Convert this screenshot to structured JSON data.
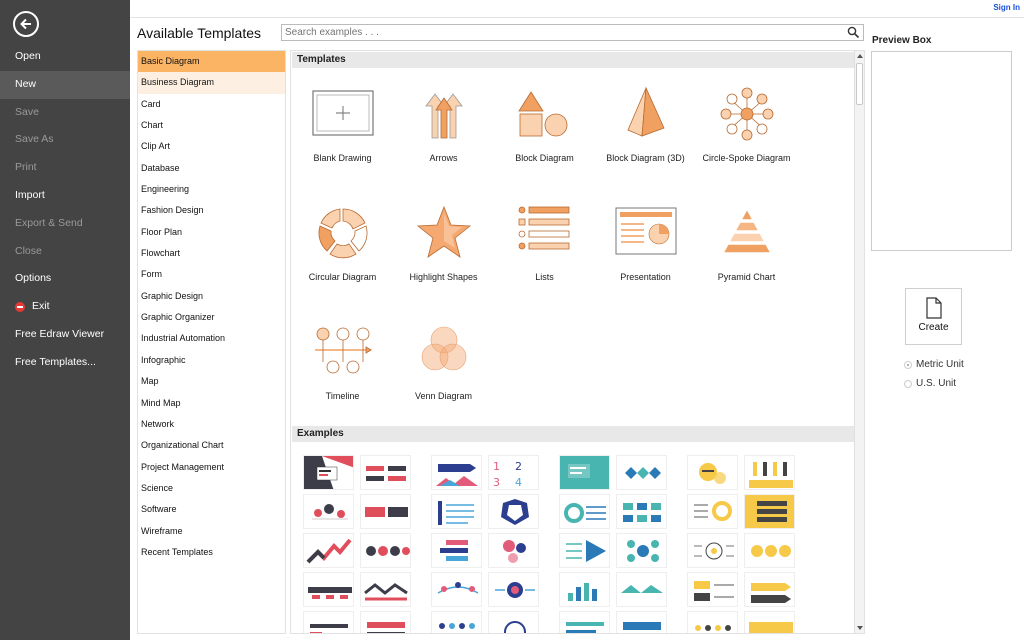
{
  "sidebar": {
    "items": [
      {
        "label": "Open",
        "state": "normal"
      },
      {
        "label": "New",
        "state": "active"
      },
      {
        "label": "Save",
        "state": "disabled"
      },
      {
        "label": "Save As",
        "state": "disabled"
      },
      {
        "label": "Print",
        "state": "disabled"
      },
      {
        "label": "Import",
        "state": "normal"
      },
      {
        "label": "Export & Send",
        "state": "disabled"
      },
      {
        "label": "Close",
        "state": "disabled"
      },
      {
        "label": "Options",
        "state": "normal"
      },
      {
        "label": "Exit",
        "state": "normal",
        "icon": "exit-icon"
      },
      {
        "label": "Free Edraw Viewer",
        "state": "normal"
      },
      {
        "label": "Free Templates...",
        "state": "normal"
      }
    ]
  },
  "header": {
    "signin": "Sign In",
    "title": "Available Templates",
    "search_placeholder": "Search examples . . ."
  },
  "categories": {
    "items": [
      "Basic Diagram",
      "Business Diagram",
      "Card",
      "Chart",
      "Clip Art",
      "Database",
      "Engineering",
      "Fashion Design",
      "Floor Plan",
      "Flowchart",
      "Form",
      "Graphic Design",
      "Graphic Organizer",
      "Industrial Automation",
      "Infographic",
      "Map",
      "Mind Map",
      "Network",
      "Organizational Chart",
      "Project Management",
      "Science",
      "Software",
      "Wireframe",
      "Recent Templates"
    ],
    "selected": "Basic Diagram",
    "hovered": "Business Diagram"
  },
  "main": {
    "templates_header": "Templates",
    "examples_header": "Examples",
    "templates": [
      {
        "label": "Blank Drawing",
        "icon": "blank-drawing-icon"
      },
      {
        "label": "Arrows",
        "icon": "arrows-icon"
      },
      {
        "label": "Block Diagram",
        "icon": "block-diagram-icon"
      },
      {
        "label": "Block Diagram (3D)",
        "icon": "block-diagram-3d-icon"
      },
      {
        "label": "Circle-Spoke Diagram",
        "icon": "circle-spoke-icon"
      },
      {
        "label": "Circular Diagram",
        "icon": "circular-diagram-icon"
      },
      {
        "label": "Highlight Shapes",
        "icon": "highlight-shapes-icon"
      },
      {
        "label": "Lists",
        "icon": "lists-icon"
      },
      {
        "label": "Presentation",
        "icon": "presentation-icon"
      },
      {
        "label": "Pyramid Chart",
        "icon": "pyramid-chart-icon"
      },
      {
        "label": "Timeline",
        "icon": "timeline-icon"
      },
      {
        "label": "Venn Diagram",
        "icon": "venn-diagram-icon"
      }
    ]
  },
  "right": {
    "preview_title": "Preview Box",
    "create_label": "Create",
    "units": [
      {
        "label": "Metric Unit",
        "selected": true
      },
      {
        "label": "U.S. Unit",
        "selected": false
      }
    ]
  },
  "colors": {
    "accent_orange": "#f0a060",
    "light_orange": "#fbd2b0",
    "sidebar_bg": "#444444",
    "selected_category": "#fbb463"
  }
}
